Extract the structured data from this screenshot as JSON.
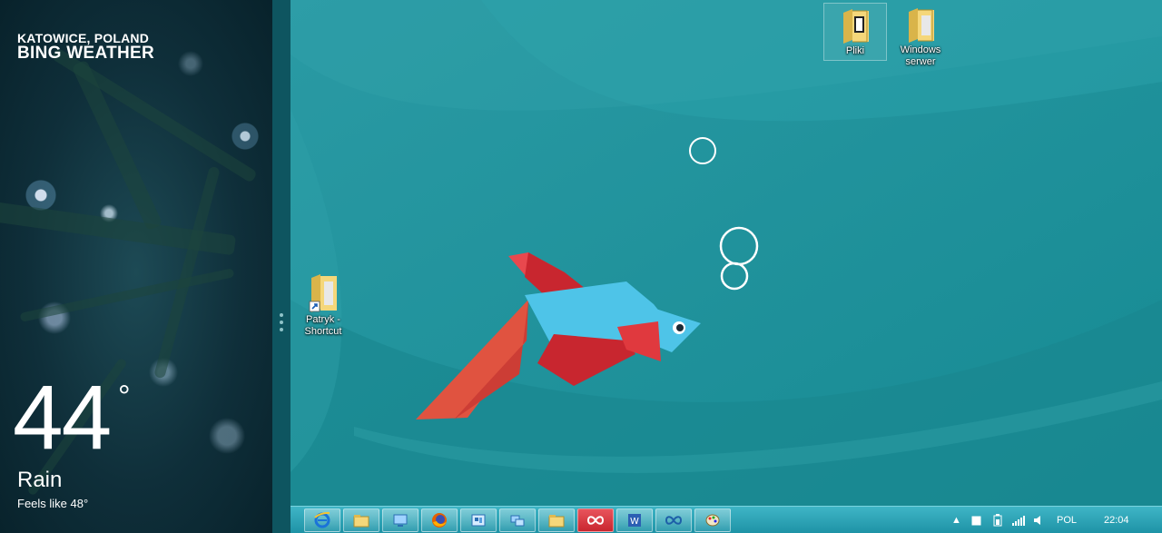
{
  "weather": {
    "location": "KATOWICE, POLAND",
    "app_name": "BING WEATHER",
    "temperature": "44",
    "degree_symbol": "°",
    "condition": "Rain",
    "feels_like": "Feels like 48°"
  },
  "desktop": {
    "icons": [
      {
        "label": "Pliki"
      },
      {
        "label": "Windows serwer"
      },
      {
        "label": "Patryk - Shortcut"
      }
    ]
  },
  "taskbar": {
    "buttons": [
      "internet-explorer-icon",
      "file-explorer-icon",
      "computer-icon",
      "firefox-icon",
      "control-panel-icon",
      "network-icon",
      "folder-icon",
      "infinity-app-icon",
      "word-icon",
      "infinity-app-icon",
      "paint-icon"
    ],
    "tray": {
      "language": "POL",
      "time": "22:04"
    }
  },
  "colors": {
    "desktop_bg": "#1a8d98",
    "taskbar_accent": "#3fb5c6",
    "fish_blue": "#4ec4e8",
    "fish_red": "#c8262f"
  }
}
